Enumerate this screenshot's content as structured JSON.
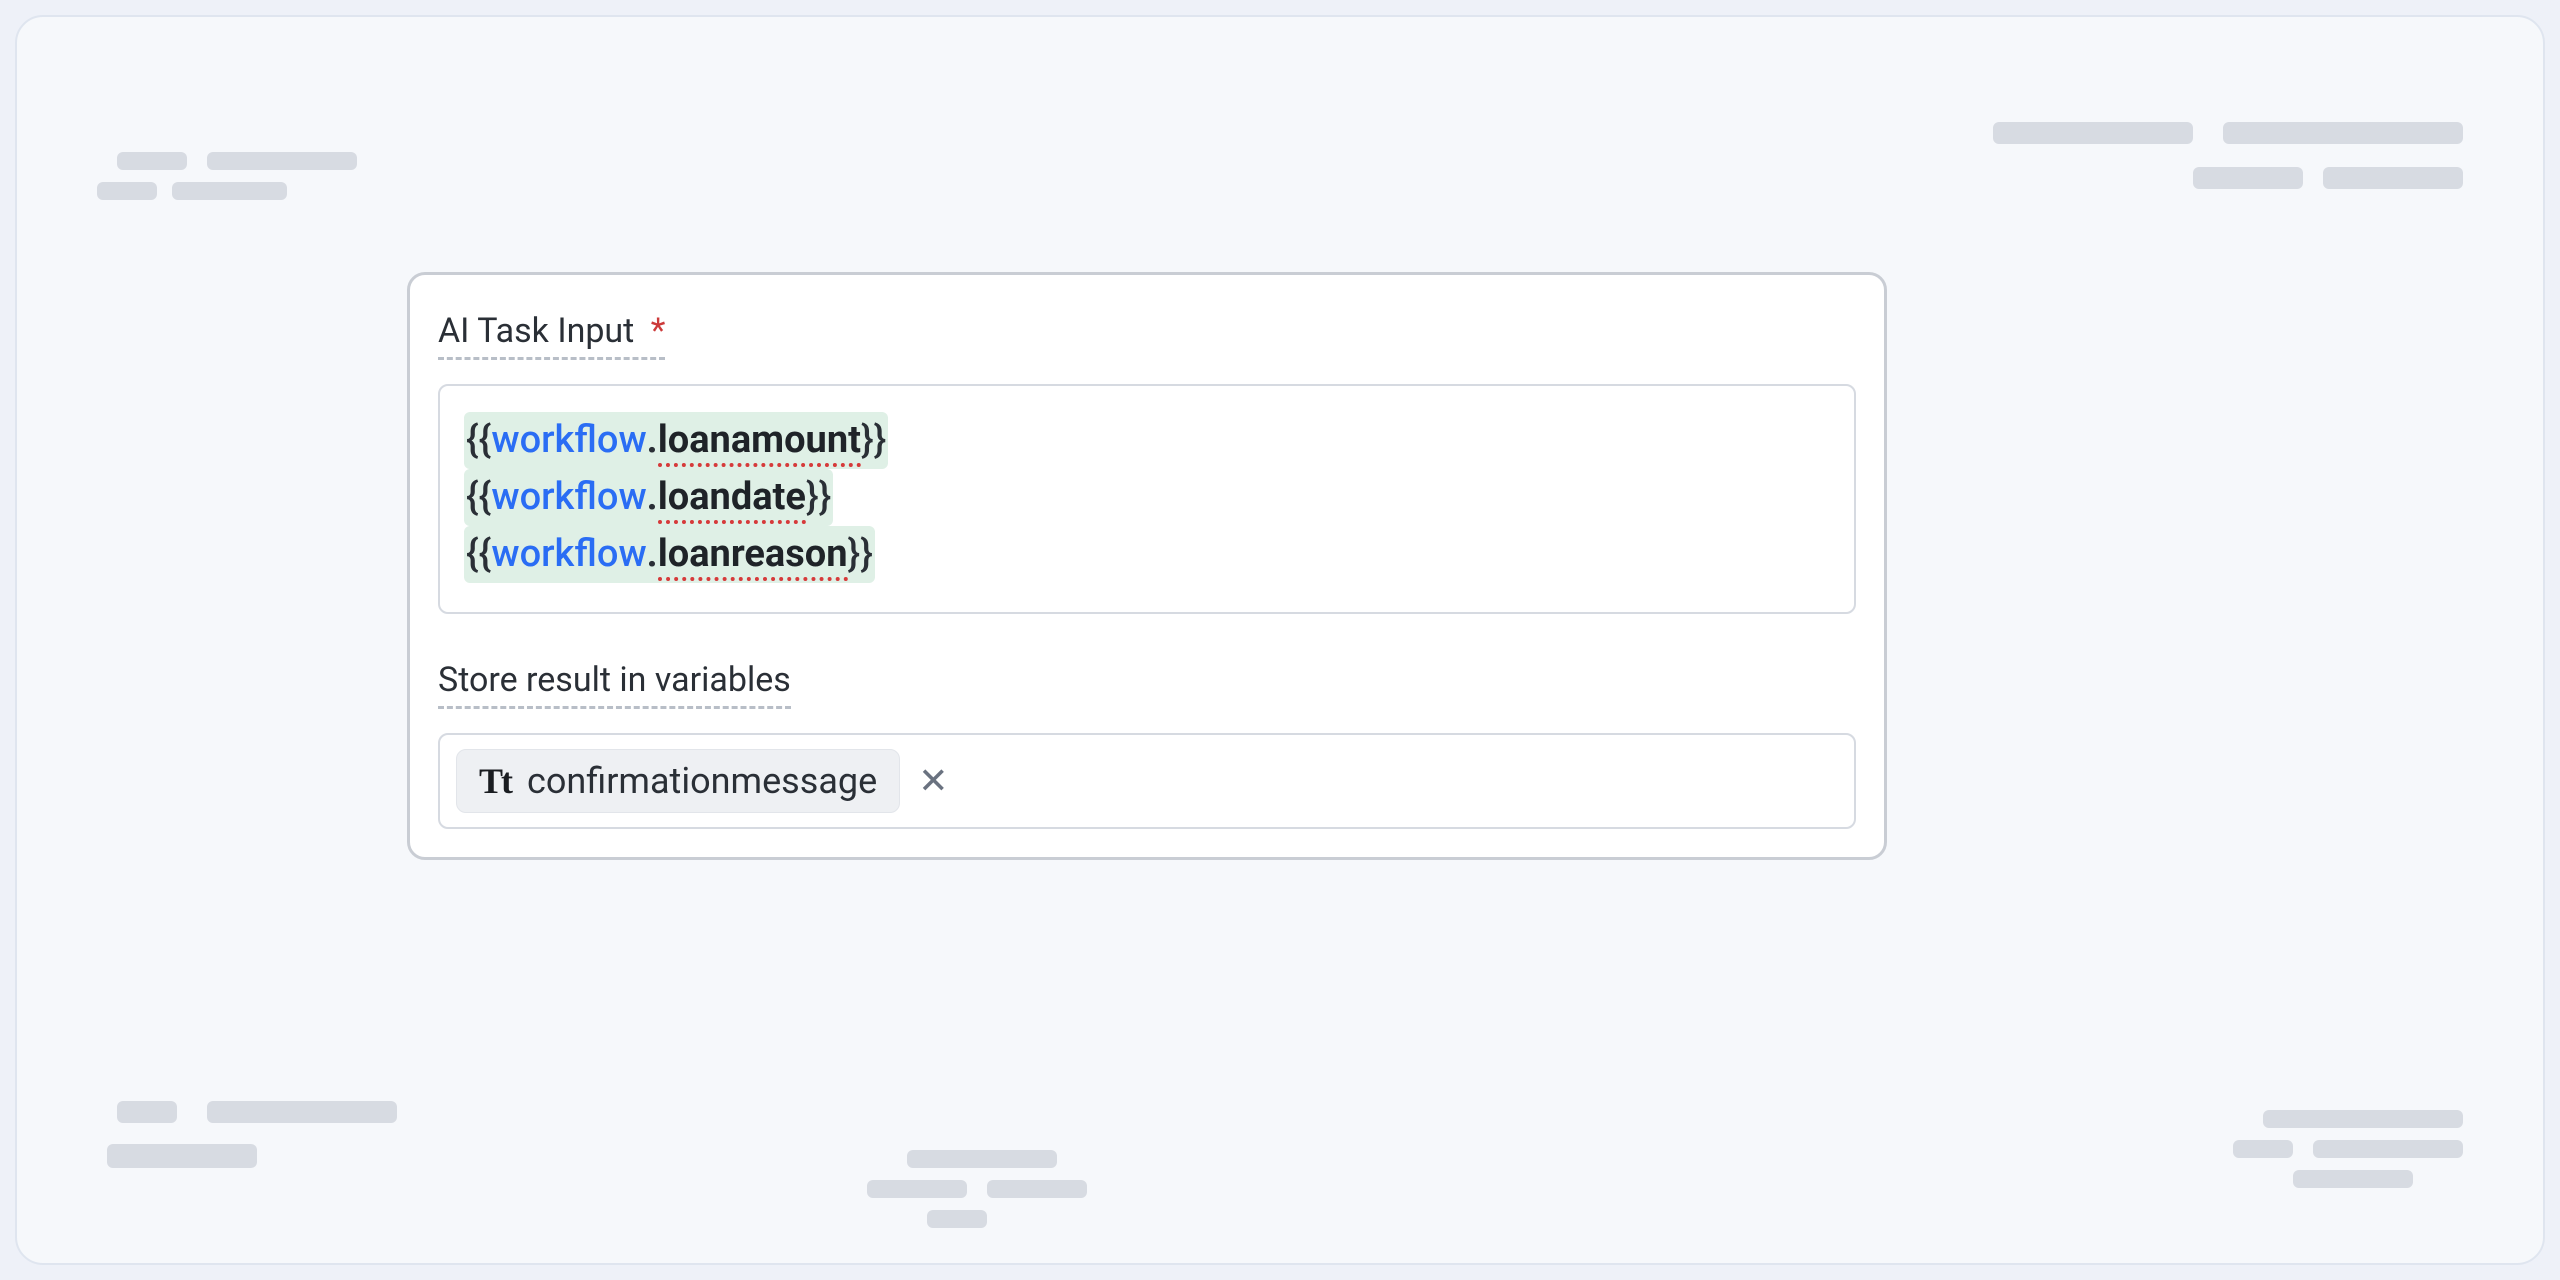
{
  "card": {
    "input_label": "AI Task Input",
    "required_mark": "*",
    "template_lines": [
      {
        "ns": "workflow",
        "name": "loanamount"
      },
      {
        "ns": "workflow",
        "name": "loandate"
      },
      {
        "ns": "workflow",
        "name": "loanreason"
      }
    ],
    "store_label": "Store result in variables",
    "variable_chip": {
      "type_glyph": "Tt",
      "name": "confirmationmessage"
    },
    "remove_glyph": "✕"
  }
}
